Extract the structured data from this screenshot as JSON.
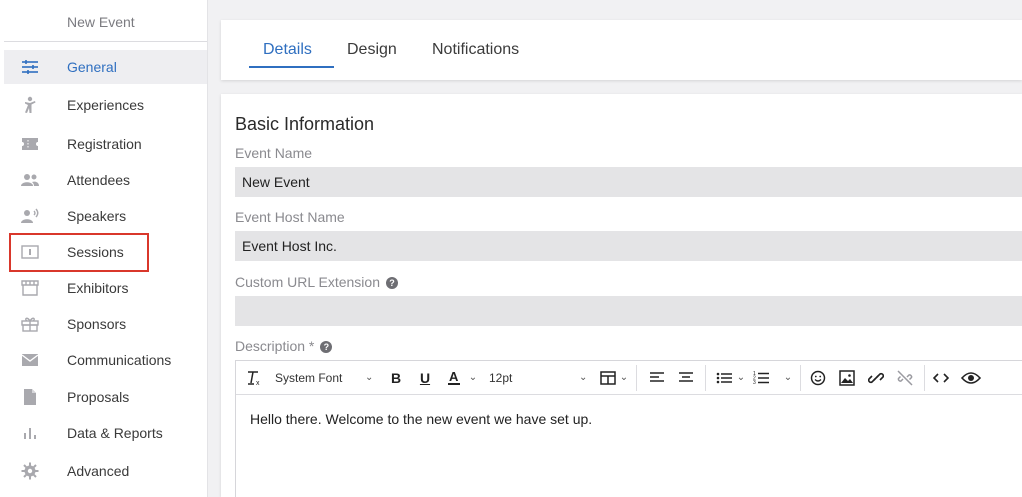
{
  "sidebar": {
    "title": "New Event",
    "items": [
      {
        "label": "General",
        "icon": "sliders-icon"
      },
      {
        "label": "Experiences",
        "icon": "person-icon"
      },
      {
        "label": "Registration",
        "icon": "ticket-icon"
      },
      {
        "label": "Attendees",
        "icon": "people-icon"
      },
      {
        "label": "Speakers",
        "icon": "speaker-icon"
      },
      {
        "label": "Sessions",
        "icon": "session-icon"
      },
      {
        "label": "Exhibitors",
        "icon": "booth-icon"
      },
      {
        "label": "Sponsors",
        "icon": "gift-icon"
      },
      {
        "label": "Communications",
        "icon": "mail-icon"
      },
      {
        "label": "Proposals",
        "icon": "document-icon"
      },
      {
        "label": "Data & Reports",
        "icon": "bar-chart-icon"
      },
      {
        "label": "Advanced",
        "icon": "gear-icon"
      }
    ],
    "active": "General",
    "highlighted": "Sessions"
  },
  "tabs": [
    {
      "label": "Details",
      "active": true
    },
    {
      "label": "Design",
      "active": false
    },
    {
      "label": "Notifications",
      "active": false
    }
  ],
  "form": {
    "section_title": "Basic Information",
    "event_name_label": "Event Name",
    "event_name_value": "New Event",
    "host_name_label": "Event Host Name",
    "host_name_value": "Event Host Inc.",
    "url_ext_label": "Custom URL Extension",
    "url_ext_value": "",
    "description_label": "Description *"
  },
  "editor": {
    "font_family": "System Font",
    "font_size": "12pt",
    "content": "Hello there. Welcome to the new event we have set up.",
    "toolbar_icons": [
      "clear-format-icon",
      "bold-icon",
      "underline-icon",
      "text-color-icon",
      "table-icon",
      "align-left-icon",
      "align-center-icon",
      "bullet-list-icon",
      "numbered-list-icon",
      "emoji-icon",
      "image-icon",
      "link-icon",
      "unlink-icon",
      "code-icon",
      "preview-icon"
    ]
  },
  "colors": {
    "accent": "#2f6fc0",
    "highlight_border": "#d9372b",
    "input_bg": "#e4e4e6"
  }
}
